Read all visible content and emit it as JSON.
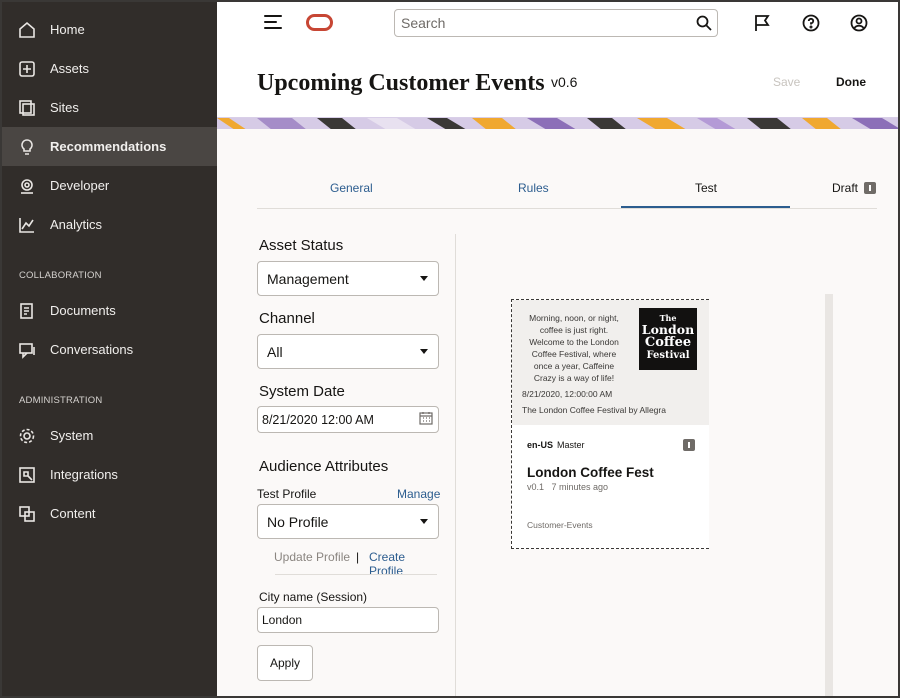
{
  "sidebar": {
    "items": [
      {
        "label": "Home",
        "icon": "home-icon"
      },
      {
        "label": "Assets",
        "icon": "assets-icon"
      },
      {
        "label": "Sites",
        "icon": "sites-icon"
      },
      {
        "label": "Recommendations",
        "icon": "lightbulb-icon",
        "active": true
      },
      {
        "label": "Developer",
        "icon": "developer-icon"
      },
      {
        "label": "Analytics",
        "icon": "analytics-icon"
      }
    ],
    "collaboration_label": "COLLABORATION",
    "collaboration_items": [
      {
        "label": "Documents",
        "icon": "documents-icon"
      },
      {
        "label": "Conversations",
        "icon": "conversations-icon"
      }
    ],
    "administration_label": "ADMINISTRATION",
    "administration_items": [
      {
        "label": "System",
        "icon": "gear-icon"
      },
      {
        "label": "Integrations",
        "icon": "integrations-icon"
      },
      {
        "label": "Content",
        "icon": "content-icon"
      }
    ]
  },
  "header": {
    "search_placeholder": "Search",
    "brand_color": "#c74634"
  },
  "page": {
    "title": "Upcoming Customer Events",
    "version": "v0.6",
    "save_label": "Save",
    "done_label": "Done"
  },
  "tabs": [
    {
      "label": "General"
    },
    {
      "label": "Rules"
    },
    {
      "label": "Test",
      "selected": true
    },
    {
      "label": "Draft"
    }
  ],
  "form": {
    "asset_status_label": "Asset Status",
    "asset_status_value": "Management",
    "channel_label": "Channel",
    "channel_value": "All",
    "system_date_label": "System Date",
    "system_date_value": "8/21/2020 12:00 AM",
    "audience_label": "Audience Attributes",
    "test_profile_label": "Test Profile",
    "manage_label": "Manage",
    "profile_value": "No Profile",
    "update_profile_label": "Update Profile",
    "separator": "|",
    "create_profile_label": "Create Profile",
    "city_label": "City name (Session)",
    "city_value": "London",
    "apply_label": "Apply"
  },
  "preview": {
    "blurb": "Morning, noon, or night, coffee is just right. Welcome to the London Coffee Festival, where once a year, Caffeine Crazy is a way of life!",
    "logo_line1": "The",
    "logo_line2": "London",
    "logo_line3": "Coffee",
    "logo_line4": "Festival",
    "date": "8/21/2020, 12:00:00 AM",
    "source": "The London Coffee Festival by Allegra",
    "locale": "en-US",
    "master": "Master",
    "name": "London Coffee Fest",
    "version": "v0.1",
    "updated": "7 minutes ago",
    "type": "Customer-Events"
  }
}
